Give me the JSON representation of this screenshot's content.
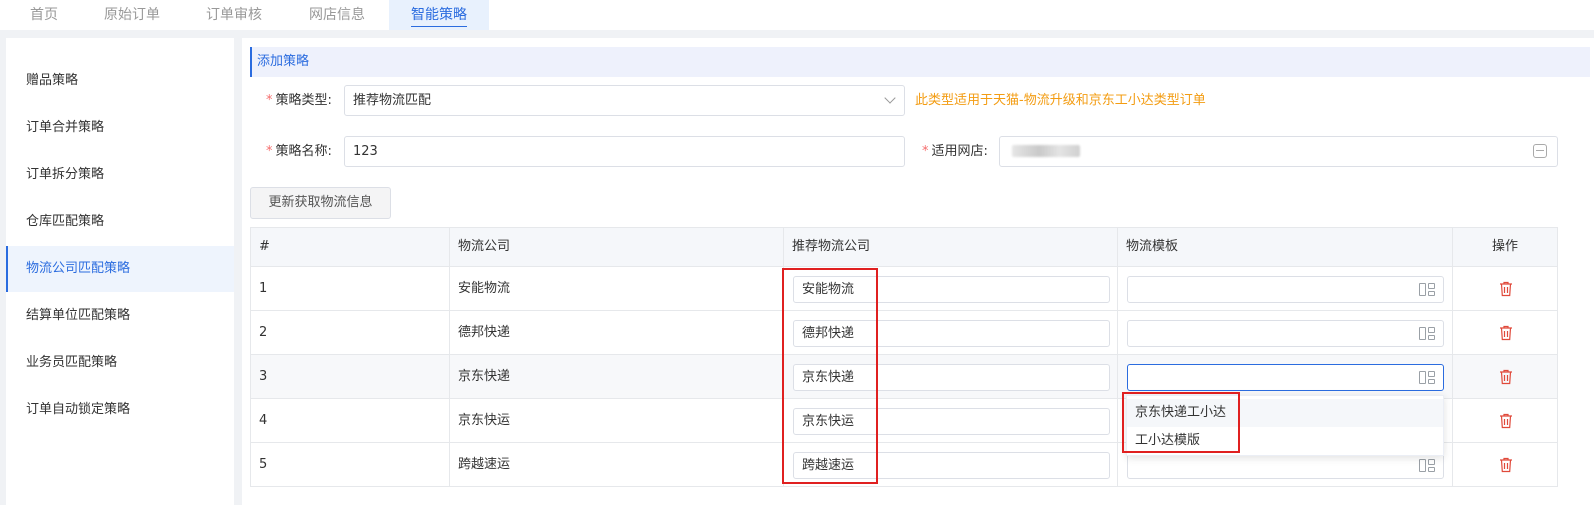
{
  "top_tabs": [
    {
      "label": "首页"
    },
    {
      "label": "原始订单"
    },
    {
      "label": "订单审核"
    },
    {
      "label": "网店信息"
    },
    {
      "label": "智能策略"
    }
  ],
  "sidebar": {
    "items": [
      {
        "label": "赠品策略"
      },
      {
        "label": "订单合并策略"
      },
      {
        "label": "订单拆分策略"
      },
      {
        "label": "仓库匹配策略"
      },
      {
        "label": "物流公司匹配策略"
      },
      {
        "label": "结算单位匹配策略"
      },
      {
        "label": "业务员匹配策略"
      },
      {
        "label": "订单自动锁定策略"
      }
    ]
  },
  "form": {
    "section_title": "添加策略",
    "required_mark": "*",
    "type_label": "策略类型:",
    "type_value": "推荐物流匹配",
    "type_hint": "此类型适用于天猫-物流升级和京东工小达类型订单",
    "name_label": "策略名称:",
    "name_value": "123",
    "store_label": "适用网店:",
    "refresh_button": "更新获取物流信息"
  },
  "table": {
    "headers": [
      "#",
      "物流公司",
      "推荐物流公司",
      "物流模板",
      "操作"
    ],
    "rows": [
      {
        "index": "1",
        "company": "安能物流",
        "recommended": "安能物流",
        "template": ""
      },
      {
        "index": "2",
        "company": "德邦快递",
        "recommended": "德邦快递",
        "template": ""
      },
      {
        "index": "3",
        "company": "京东快递",
        "recommended": "京东快递",
        "template": ""
      },
      {
        "index": "4",
        "company": "京东快运",
        "recommended": "京东快运",
        "template": ""
      },
      {
        "index": "5",
        "company": "跨越速运",
        "recommended": "跨越速运",
        "template": ""
      }
    ]
  },
  "template_dropdown": {
    "options": [
      "京东快递工小达",
      "工小达模版"
    ]
  },
  "colors": {
    "accent": "#2b6cdf",
    "hint": "#f39c12",
    "danger": "#e02020",
    "required": "#f56c6c"
  },
  "icons": [
    "chevron-down-icon",
    "store-select-icon",
    "template-select-icon",
    "trash-icon"
  ]
}
